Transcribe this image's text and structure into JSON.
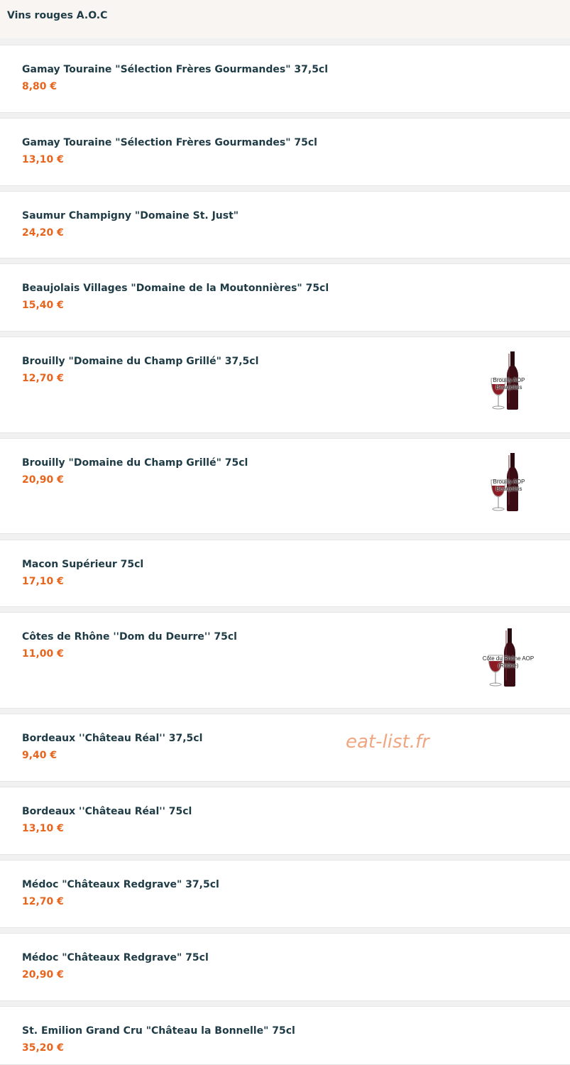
{
  "section": {
    "title": "Vins rouges A.O.C"
  },
  "items": [
    {
      "name": "Gamay Touraine \"Sélection Frères Gourmandes\" 37,5cl",
      "price": "8,80 €"
    },
    {
      "name": "Gamay Touraine \"Sélection Frères Gourmandes\" 75cl",
      "price": "13,10 €"
    },
    {
      "name": "Saumur Champigny \"Domaine St. Just\"",
      "price": "24,20 €"
    },
    {
      "name": "Beaujolais Villages \"Domaine de la Moutonnières\" 75cl",
      "price": "15,40 €"
    },
    {
      "name": "Brouilly \"Domaine du Champ Grillé\" 37,5cl",
      "price": "12,70 €",
      "image_label": [
        "Brouilly AOP",
        "Beaujolais"
      ]
    },
    {
      "name": "Brouilly \"Domaine du Champ Grillé\" 75cl",
      "price": "20,90 €",
      "image_label": [
        "Brouilly AOP",
        "Beaujolais"
      ]
    },
    {
      "name": "Macon Supérieur 75cl",
      "price": "17,10 €"
    },
    {
      "name": "Côtes de Rhône ''Dom du Deurre'' 75cl",
      "price": "11,00 €",
      "image_label": [
        "Côte du Rhône AOP",
        "(Rhône)"
      ]
    },
    {
      "name": "Bordeaux ''Château Réal'' 37,5cl",
      "price": "9,40 €"
    },
    {
      "name": "Bordeaux ''Château Réal'' 75cl",
      "price": "13,10 €"
    },
    {
      "name": "Médoc \"Châteaux Redgrave\" 37,5cl",
      "price": "12,70 €"
    },
    {
      "name": "Médoc \"Châteaux Redgrave\" 75cl",
      "price": "20,90 €"
    },
    {
      "name": "St. Emilion Grand Cru \"Château la Bonnelle\" 75cl",
      "price": "35,20 €"
    }
  ],
  "watermark": "eat-list.fr",
  "colors": {
    "title": "#1e3b46",
    "price": "#e7641d",
    "header_bg": "#f8f5f2",
    "watermark": "#f0a681"
  }
}
